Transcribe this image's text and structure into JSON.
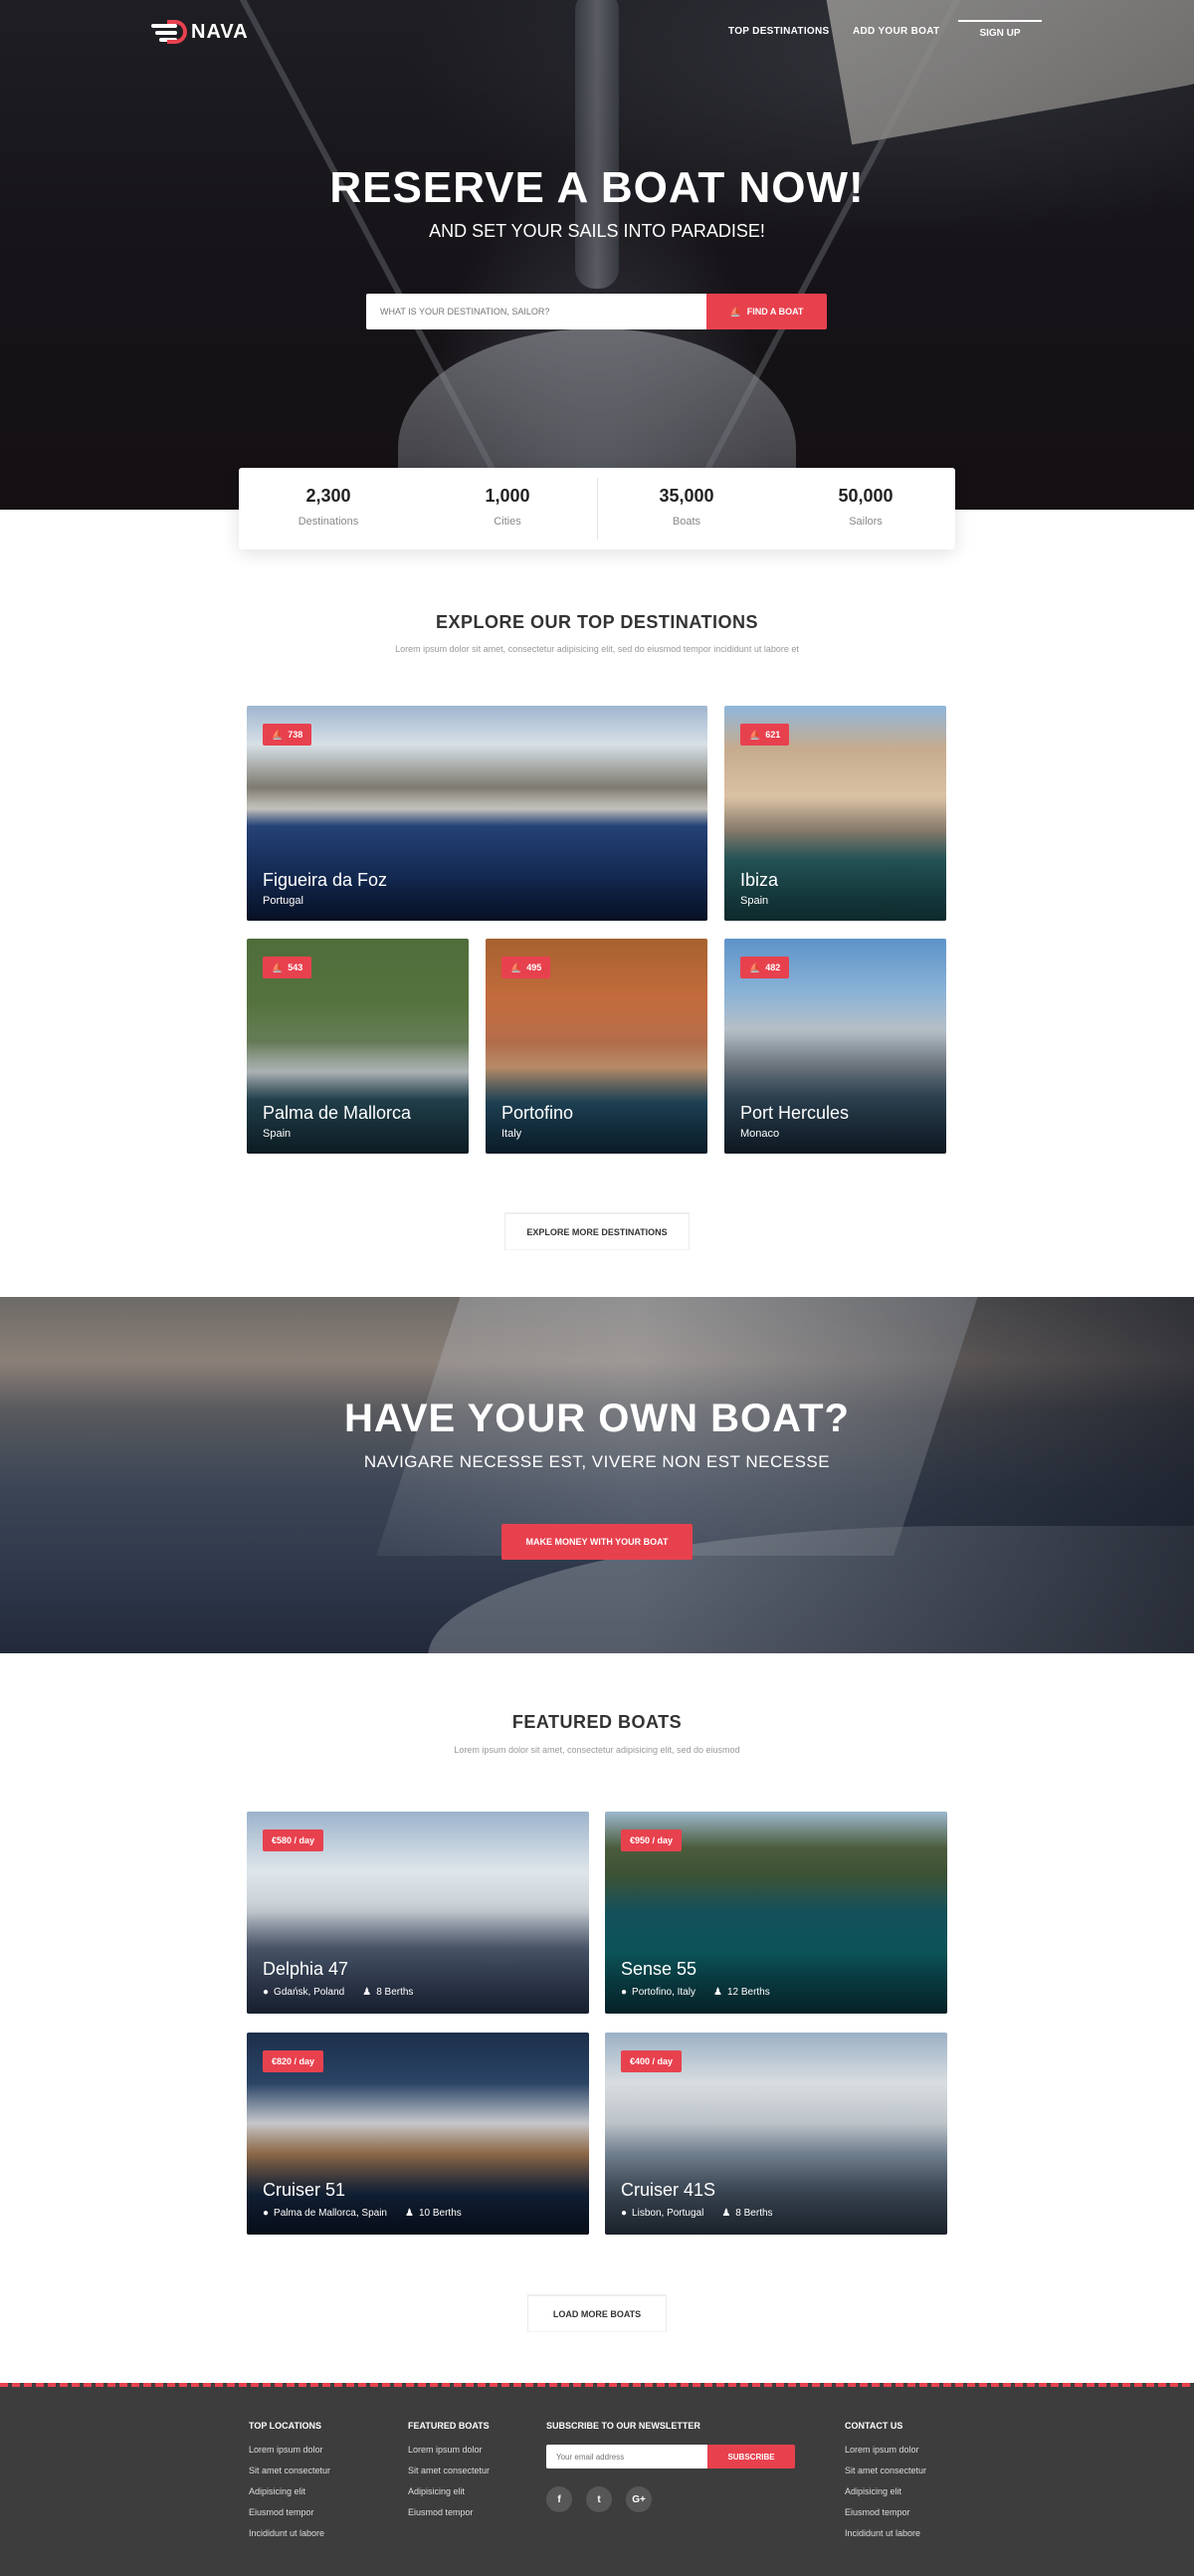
{
  "brand": {
    "name": "NAVA",
    "accent": "#e8414e"
  },
  "nav": {
    "links": [
      "TOP DESTINATIONS",
      "ADD YOUR BOAT"
    ],
    "signup": "SIGN UP"
  },
  "hero": {
    "title": "RESERVE A BOAT NOW!",
    "subtitle": "AND SET YOUR SAILS INTO PARADISE!",
    "search_placeholder": "WHAT IS YOUR DESTINATION, SAILOR?",
    "search_button": "FIND A BOAT"
  },
  "stats": [
    {
      "value": "2,300",
      "label": "Destinations"
    },
    {
      "value": "1,000",
      "label": "Cities"
    },
    {
      "value": "35,000",
      "label": "Boats"
    },
    {
      "value": "50,000",
      "label": "Sailors"
    }
  ],
  "destinations": {
    "title": "EXPLORE OUR TOP DESTINATIONS",
    "subtitle": "Lorem ipsum dolor sit amet, consectetur adipisicing elit, sed do eiusmod tempor incididunt ut labore et",
    "items": [
      {
        "name": "Figueira da Foz",
        "country": "Portugal",
        "count": "738"
      },
      {
        "name": "Ibiza",
        "country": "Spain",
        "count": "621"
      },
      {
        "name": "Palma de Mallorca",
        "country": "Spain",
        "count": "543"
      },
      {
        "name": "Portofino",
        "country": "Italy",
        "count": "495"
      },
      {
        "name": "Port Hercules",
        "country": "Monaco",
        "count": "482"
      }
    ],
    "more_button": "EXPLORE MORE DESTINATIONS"
  },
  "cta": {
    "title": "HAVE YOUR OWN BOAT?",
    "subtitle": "NAVIGARE NECESSE EST, VIVERE NON EST NECESSE",
    "button": "MAKE MONEY WITH YOUR BOAT"
  },
  "featured": {
    "title": "FEATURED BOATS",
    "subtitle": "Lorem ipsum dolor sit amet, consectetur adipisicing elit, sed do eiusmod",
    "items": [
      {
        "name": "Delphia 47",
        "price": "€580 / day",
        "location": "Gdańsk, Poland",
        "berths": "8 Berths"
      },
      {
        "name": "Sense 55",
        "price": "€950 / day",
        "location": "Portofino, Italy",
        "berths": "12 Berths"
      },
      {
        "name": "Cruiser 51",
        "price": "€820 / day",
        "location": "Palma de Mallorca, Spain",
        "berths": "10 Berths"
      },
      {
        "name": "Cruiser 41S",
        "price": "€400 / day",
        "location": "Lisbon, Portugal",
        "berths": "8 Berths"
      }
    ],
    "more_button": "LOAD MORE BOATS"
  },
  "footer": {
    "top_locations": {
      "title": "TOP LOCATIONS",
      "items": [
        "Lorem ipsum dolor",
        "Sit amet consectetur",
        "Adipisicing elit",
        "Eiusmod tempor",
        "Incididunt ut labore"
      ]
    },
    "featured_boats": {
      "title": "FEATURED BOATS",
      "items": [
        "Lorem ipsum dolor",
        "Sit amet consectetur",
        "Adipisicing elit",
        "Eiusmod tempor"
      ]
    },
    "newsletter": {
      "title": "SUBSCRIBE TO OUR NEWSLETTER",
      "placeholder": "Your email address",
      "button": "SUBSCRIBE"
    },
    "socials": [
      "facebook-icon",
      "twitter-icon",
      "google-plus-icon"
    ],
    "contact": {
      "title": "CONTACT US",
      "items": [
        "Lorem ipsum dolor",
        "Sit amet consectetur",
        "Adipisicing elit",
        "Eiusmod tempor",
        "Incididunt ut labore"
      ]
    }
  }
}
